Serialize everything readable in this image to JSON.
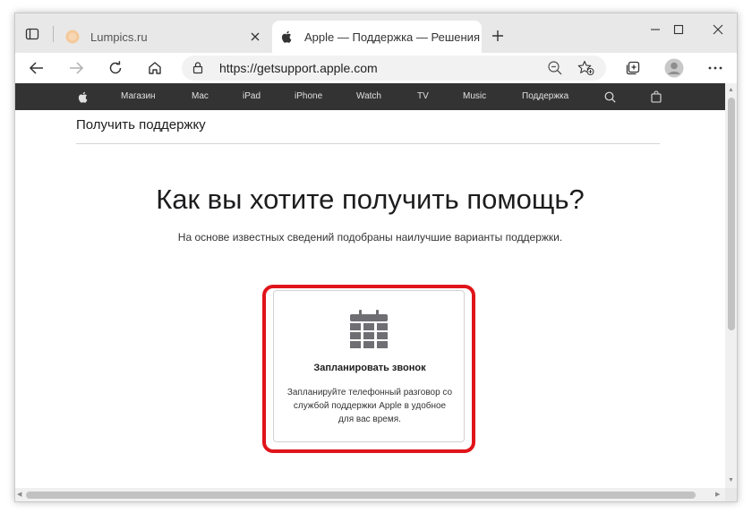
{
  "tabs": [
    {
      "title": "Lumpics.ru",
      "favicon": "lumpics-favicon",
      "active": false
    },
    {
      "title": "Apple — Поддержка — Решения",
      "favicon": "apple-logo-icon",
      "active": true
    }
  ],
  "address_bar": {
    "url": "https://getsupport.apple.com"
  },
  "apple_nav": {
    "items": [
      "Магазин",
      "Mac",
      "iPad",
      "iPhone",
      "Watch",
      "TV",
      "Music",
      "Поддержка"
    ]
  },
  "page": {
    "section_title": "Получить поддержку",
    "hero_title": "Как вы хотите получить помощь?",
    "hero_subtitle": "На основе известных сведений подобраны наилучшие варианты поддержки.",
    "card": {
      "icon": "calendar-icon",
      "title": "Запланировать звонок",
      "description": "Запланируйте телефонный разговор со службой поддержки Apple в удобное для вас время."
    }
  },
  "colors": {
    "highlight": "#e0141a",
    "apple_nav_bg": "#333333",
    "calendar_icon": "#6e6e73"
  }
}
